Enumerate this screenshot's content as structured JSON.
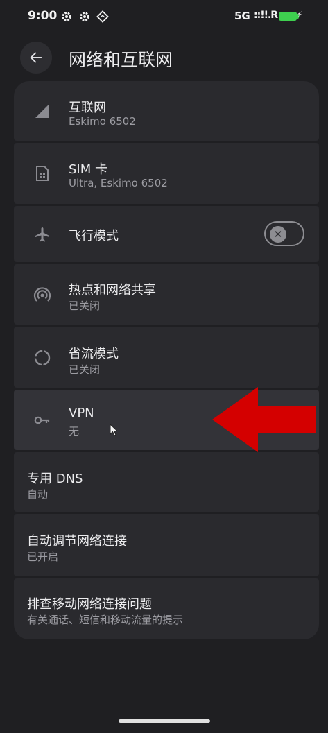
{
  "status_bar": {
    "time": "9:00",
    "network": "5G",
    "signal": "::!!.R",
    "icons": [
      "settings-gear-icon",
      "settings-gear-icon",
      "location-diamond-icon",
      "battery-charging-icon"
    ]
  },
  "header": {
    "back_icon": "arrow-left-icon",
    "title": "网络和互联网"
  },
  "items": [
    {
      "icon": "signal-triangle-icon",
      "title": "互联网",
      "subtitle": "Eskimo 6502"
    },
    {
      "icon": "sim-card-icon",
      "title": "SIM 卡",
      "subtitle": "Ultra, Eskimo 6502"
    },
    {
      "icon": "airplane-icon",
      "title": "飞行模式",
      "toggle": "off"
    },
    {
      "icon": "hotspot-icon",
      "title": "热点和网络共享",
      "subtitle": "已关闭"
    },
    {
      "icon": "data-saver-icon",
      "title": "省流模式",
      "subtitle": "已关闭"
    },
    {
      "icon": "vpn-key-icon",
      "title": "VPN",
      "subtitle": "无"
    },
    {
      "title": "专用 DNS",
      "subtitle": "自动"
    },
    {
      "title": "自动调节网络连接",
      "subtitle": "已开启"
    },
    {
      "title": "排查移动网络连接问题",
      "subtitle": "有关通话、短信和移动流量的提示"
    }
  ],
  "colors": {
    "background": "#1f1f22",
    "card": "#2a2a2e",
    "highlight_arrow": "#d40000",
    "battery": "#3ecf4f"
  }
}
